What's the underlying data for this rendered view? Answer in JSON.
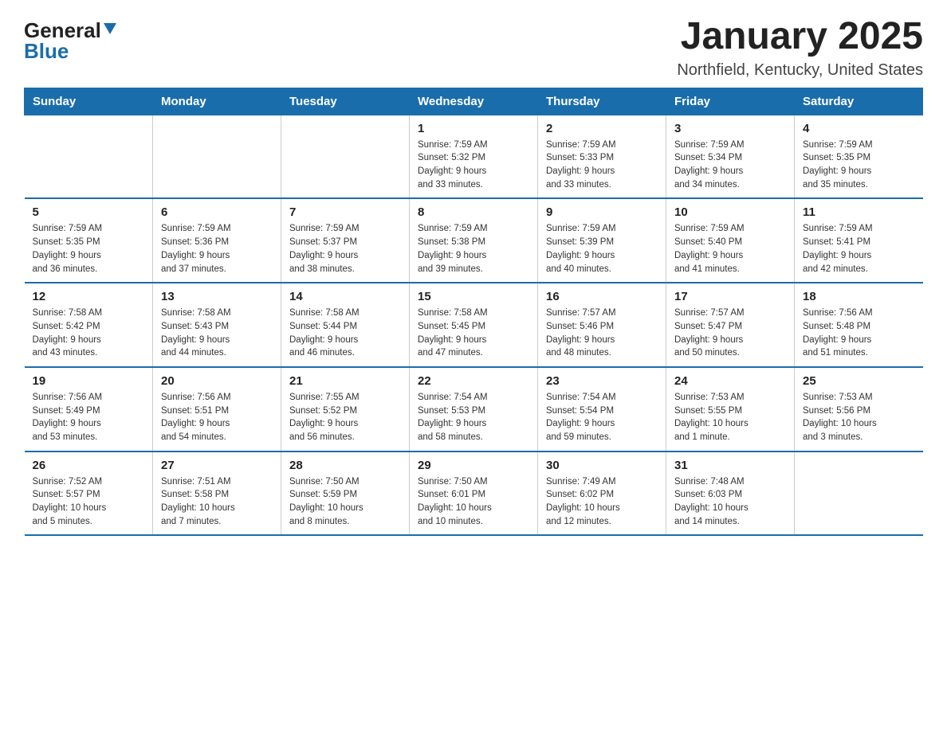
{
  "header": {
    "logo_general": "General",
    "logo_blue": "Blue",
    "month_title": "January 2025",
    "location": "Northfield, Kentucky, United States"
  },
  "weekdays": [
    "Sunday",
    "Monday",
    "Tuesday",
    "Wednesday",
    "Thursday",
    "Friday",
    "Saturday"
  ],
  "weeks": [
    [
      {
        "day": "",
        "info": ""
      },
      {
        "day": "",
        "info": ""
      },
      {
        "day": "",
        "info": ""
      },
      {
        "day": "1",
        "info": "Sunrise: 7:59 AM\nSunset: 5:32 PM\nDaylight: 9 hours\nand 33 minutes."
      },
      {
        "day": "2",
        "info": "Sunrise: 7:59 AM\nSunset: 5:33 PM\nDaylight: 9 hours\nand 33 minutes."
      },
      {
        "day": "3",
        "info": "Sunrise: 7:59 AM\nSunset: 5:34 PM\nDaylight: 9 hours\nand 34 minutes."
      },
      {
        "day": "4",
        "info": "Sunrise: 7:59 AM\nSunset: 5:35 PM\nDaylight: 9 hours\nand 35 minutes."
      }
    ],
    [
      {
        "day": "5",
        "info": "Sunrise: 7:59 AM\nSunset: 5:35 PM\nDaylight: 9 hours\nand 36 minutes."
      },
      {
        "day": "6",
        "info": "Sunrise: 7:59 AM\nSunset: 5:36 PM\nDaylight: 9 hours\nand 37 minutes."
      },
      {
        "day": "7",
        "info": "Sunrise: 7:59 AM\nSunset: 5:37 PM\nDaylight: 9 hours\nand 38 minutes."
      },
      {
        "day": "8",
        "info": "Sunrise: 7:59 AM\nSunset: 5:38 PM\nDaylight: 9 hours\nand 39 minutes."
      },
      {
        "day": "9",
        "info": "Sunrise: 7:59 AM\nSunset: 5:39 PM\nDaylight: 9 hours\nand 40 minutes."
      },
      {
        "day": "10",
        "info": "Sunrise: 7:59 AM\nSunset: 5:40 PM\nDaylight: 9 hours\nand 41 minutes."
      },
      {
        "day": "11",
        "info": "Sunrise: 7:59 AM\nSunset: 5:41 PM\nDaylight: 9 hours\nand 42 minutes."
      }
    ],
    [
      {
        "day": "12",
        "info": "Sunrise: 7:58 AM\nSunset: 5:42 PM\nDaylight: 9 hours\nand 43 minutes."
      },
      {
        "day": "13",
        "info": "Sunrise: 7:58 AM\nSunset: 5:43 PM\nDaylight: 9 hours\nand 44 minutes."
      },
      {
        "day": "14",
        "info": "Sunrise: 7:58 AM\nSunset: 5:44 PM\nDaylight: 9 hours\nand 46 minutes."
      },
      {
        "day": "15",
        "info": "Sunrise: 7:58 AM\nSunset: 5:45 PM\nDaylight: 9 hours\nand 47 minutes."
      },
      {
        "day": "16",
        "info": "Sunrise: 7:57 AM\nSunset: 5:46 PM\nDaylight: 9 hours\nand 48 minutes."
      },
      {
        "day": "17",
        "info": "Sunrise: 7:57 AM\nSunset: 5:47 PM\nDaylight: 9 hours\nand 50 minutes."
      },
      {
        "day": "18",
        "info": "Sunrise: 7:56 AM\nSunset: 5:48 PM\nDaylight: 9 hours\nand 51 minutes."
      }
    ],
    [
      {
        "day": "19",
        "info": "Sunrise: 7:56 AM\nSunset: 5:49 PM\nDaylight: 9 hours\nand 53 minutes."
      },
      {
        "day": "20",
        "info": "Sunrise: 7:56 AM\nSunset: 5:51 PM\nDaylight: 9 hours\nand 54 minutes."
      },
      {
        "day": "21",
        "info": "Sunrise: 7:55 AM\nSunset: 5:52 PM\nDaylight: 9 hours\nand 56 minutes."
      },
      {
        "day": "22",
        "info": "Sunrise: 7:54 AM\nSunset: 5:53 PM\nDaylight: 9 hours\nand 58 minutes."
      },
      {
        "day": "23",
        "info": "Sunrise: 7:54 AM\nSunset: 5:54 PM\nDaylight: 9 hours\nand 59 minutes."
      },
      {
        "day": "24",
        "info": "Sunrise: 7:53 AM\nSunset: 5:55 PM\nDaylight: 10 hours\nand 1 minute."
      },
      {
        "day": "25",
        "info": "Sunrise: 7:53 AM\nSunset: 5:56 PM\nDaylight: 10 hours\nand 3 minutes."
      }
    ],
    [
      {
        "day": "26",
        "info": "Sunrise: 7:52 AM\nSunset: 5:57 PM\nDaylight: 10 hours\nand 5 minutes."
      },
      {
        "day": "27",
        "info": "Sunrise: 7:51 AM\nSunset: 5:58 PM\nDaylight: 10 hours\nand 7 minutes."
      },
      {
        "day": "28",
        "info": "Sunrise: 7:50 AM\nSunset: 5:59 PM\nDaylight: 10 hours\nand 8 minutes."
      },
      {
        "day": "29",
        "info": "Sunrise: 7:50 AM\nSunset: 6:01 PM\nDaylight: 10 hours\nand 10 minutes."
      },
      {
        "day": "30",
        "info": "Sunrise: 7:49 AM\nSunset: 6:02 PM\nDaylight: 10 hours\nand 12 minutes."
      },
      {
        "day": "31",
        "info": "Sunrise: 7:48 AM\nSunset: 6:03 PM\nDaylight: 10 hours\nand 14 minutes."
      },
      {
        "day": "",
        "info": ""
      }
    ]
  ]
}
